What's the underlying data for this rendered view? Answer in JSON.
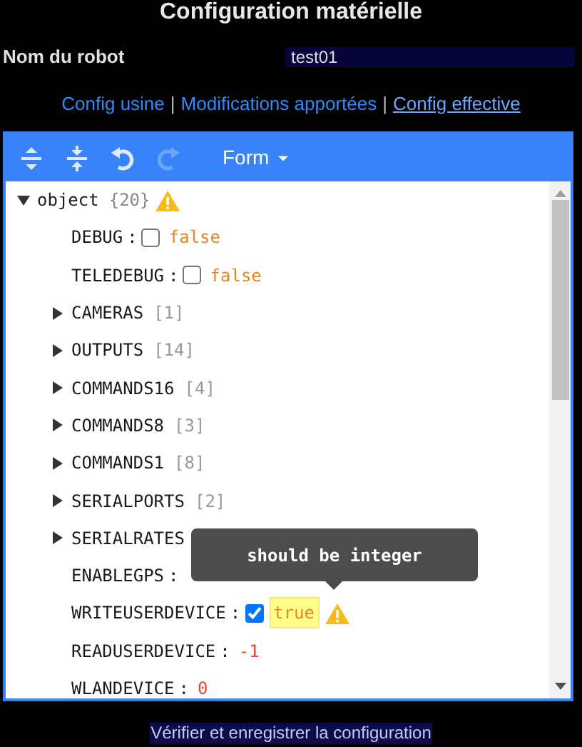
{
  "title": "Configuration matérielle",
  "robot_name": {
    "label": "Nom du robot",
    "value": "test01"
  },
  "links": [
    {
      "kind": "link",
      "label": "Config usine",
      "selected": false
    },
    {
      "kind": "separator",
      "label": "|"
    },
    {
      "kind": "link",
      "label": "Modifications apportées",
      "selected": false
    },
    {
      "kind": "separator",
      "label": "|"
    },
    {
      "kind": "link",
      "label": "Config effective",
      "selected": true
    }
  ],
  "editor": {
    "toolbar": [
      {
        "kind": "expand-all",
        "disabled": false
      },
      {
        "kind": "collapse-all",
        "disabled": false
      },
      {
        "kind": "undo",
        "disabled": false
      },
      {
        "kind": "redo",
        "disabled": true
      }
    ],
    "mode_menu": {
      "label": "Form"
    },
    "tree": {
      "key": "object",
      "count": "{20}",
      "expanded": true,
      "invalid": true,
      "children": [
        {
          "kind": "boolean",
          "key": "DEBUG",
          "separator": ":",
          "checked": false,
          "value": "false",
          "invalid": false
        },
        {
          "kind": "boolean",
          "key": "TELEDEBUG",
          "separator": ":",
          "checked": false,
          "value": "false",
          "invalid": false
        },
        {
          "kind": "array",
          "key": "CAMERAS",
          "count": "[1]",
          "expanded": false
        },
        {
          "kind": "array",
          "key": "OUTPUTS",
          "count": "[14]",
          "expanded": false
        },
        {
          "kind": "array",
          "key": "COMMANDS16",
          "count": "[4]",
          "expanded": false
        },
        {
          "kind": "array",
          "key": "COMMANDS8",
          "count": "[3]",
          "expanded": false
        },
        {
          "kind": "array",
          "key": "COMMANDS1",
          "count": "[8]",
          "expanded": false
        },
        {
          "kind": "array",
          "key": "SERIALPORTS",
          "count": "[2]",
          "expanded": false
        },
        {
          "kind": "array",
          "key": "SERIALRATES",
          "expanded": false
        },
        {
          "kind": "number",
          "key": "ENABLEGPS",
          "separator": ":"
        },
        {
          "kind": "boolean",
          "key": "WRITEUSERDEVICE",
          "separator": ":",
          "checked": true,
          "value": "true",
          "invalid": true
        },
        {
          "kind": "number",
          "key": "READUSERDEVICE",
          "separator": ":",
          "value": "-1"
        },
        {
          "kind": "number",
          "key": "WLANDEVICE",
          "separator": ":",
          "value": "0"
        }
      ]
    },
    "tooltip": {
      "text": "should be integer"
    }
  },
  "submit_button": {
    "label": "Vérifier et enregistrer la configuration"
  }
}
